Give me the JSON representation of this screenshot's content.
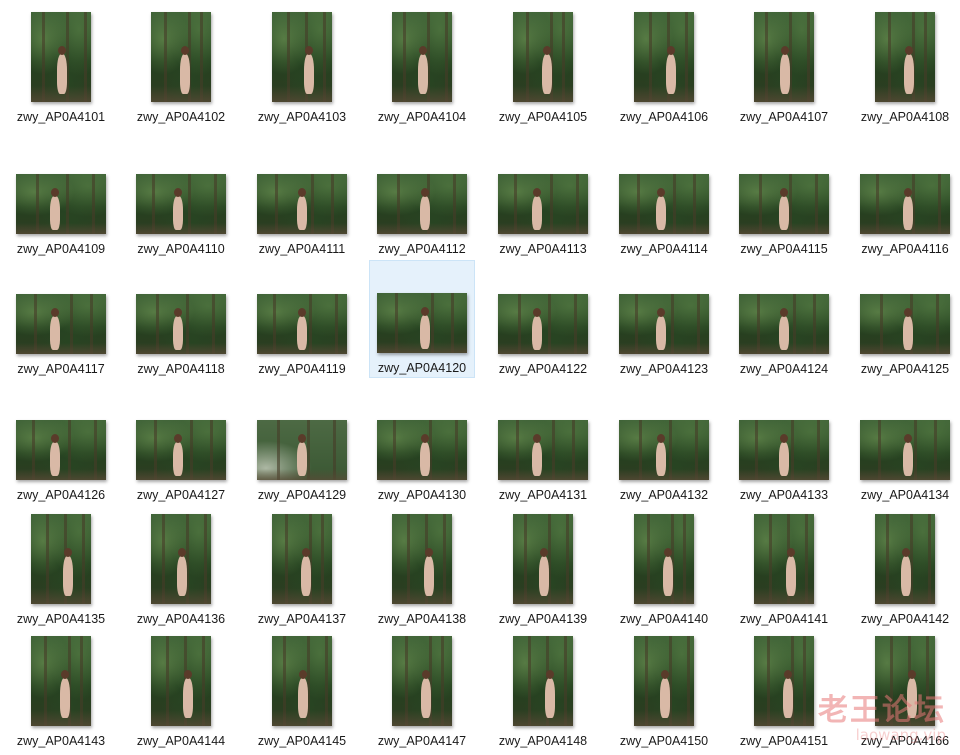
{
  "files": [
    {
      "name": "zwy_AP0A4101",
      "orientation": "portrait"
    },
    {
      "name": "zwy_AP0A4102",
      "orientation": "portrait"
    },
    {
      "name": "zwy_AP0A4103",
      "orientation": "portrait"
    },
    {
      "name": "zwy_AP0A4104",
      "orientation": "portrait"
    },
    {
      "name": "zwy_AP0A4105",
      "orientation": "portrait"
    },
    {
      "name": "zwy_AP0A4106",
      "orientation": "portrait"
    },
    {
      "name": "zwy_AP0A4107",
      "orientation": "portrait"
    },
    {
      "name": "zwy_AP0A4108",
      "orientation": "portrait"
    },
    {
      "name": "zwy_AP0A4109",
      "orientation": "landscape"
    },
    {
      "name": "zwy_AP0A4110",
      "orientation": "landscape"
    },
    {
      "name": "zwy_AP0A4111",
      "orientation": "landscape"
    },
    {
      "name": "zwy_AP0A4112",
      "orientation": "landscape"
    },
    {
      "name": "zwy_AP0A4113",
      "orientation": "landscape"
    },
    {
      "name": "zwy_AP0A4114",
      "orientation": "landscape"
    },
    {
      "name": "zwy_AP0A4115",
      "orientation": "landscape"
    },
    {
      "name": "zwy_AP0A4116",
      "orientation": "landscape"
    },
    {
      "name": "zwy_AP0A4117",
      "orientation": "landscape"
    },
    {
      "name": "zwy_AP0A4118",
      "orientation": "landscape"
    },
    {
      "name": "zwy_AP0A4119",
      "orientation": "landscape"
    },
    {
      "name": "zwy_AP0A4120",
      "orientation": "landscape",
      "selected": true
    },
    {
      "name": "zwy_AP0A4122",
      "orientation": "landscape"
    },
    {
      "name": "zwy_AP0A4123",
      "orientation": "landscape"
    },
    {
      "name": "zwy_AP0A4124",
      "orientation": "landscape"
    },
    {
      "name": "zwy_AP0A4125",
      "orientation": "landscape"
    },
    {
      "name": "zwy_AP0A4126",
      "orientation": "landscape"
    },
    {
      "name": "zwy_AP0A4127",
      "orientation": "landscape"
    },
    {
      "name": "zwy_AP0A4129",
      "orientation": "landscape",
      "variant": "pale"
    },
    {
      "name": "zwy_AP0A4130",
      "orientation": "landscape"
    },
    {
      "name": "zwy_AP0A4131",
      "orientation": "landscape"
    },
    {
      "name": "zwy_AP0A4132",
      "orientation": "landscape"
    },
    {
      "name": "zwy_AP0A4133",
      "orientation": "landscape"
    },
    {
      "name": "zwy_AP0A4134",
      "orientation": "landscape"
    },
    {
      "name": "zwy_AP0A4135",
      "orientation": "portrait"
    },
    {
      "name": "zwy_AP0A4136",
      "orientation": "portrait"
    },
    {
      "name": "zwy_AP0A4137",
      "orientation": "portrait"
    },
    {
      "name": "zwy_AP0A4138",
      "orientation": "portrait"
    },
    {
      "name": "zwy_AP0A4139",
      "orientation": "portrait"
    },
    {
      "name": "zwy_AP0A4140",
      "orientation": "portrait"
    },
    {
      "name": "zwy_AP0A4141",
      "orientation": "portrait"
    },
    {
      "name": "zwy_AP0A4142",
      "orientation": "portrait"
    },
    {
      "name": "zwy_AP0A4143",
      "orientation": "portrait"
    },
    {
      "name": "zwy_AP0A4144",
      "orientation": "portrait"
    },
    {
      "name": "zwy_AP0A4145",
      "orientation": "portrait"
    },
    {
      "name": "zwy_AP0A4147",
      "orientation": "portrait"
    },
    {
      "name": "zwy_AP0A4148",
      "orientation": "portrait"
    },
    {
      "name": "zwy_AP0A4150",
      "orientation": "portrait"
    },
    {
      "name": "zwy_AP0A4151",
      "orientation": "portrait"
    },
    {
      "name": "zwy_AP0A4166",
      "orientation": "portrait"
    }
  ],
  "selection_color": "#e5f1fb",
  "watermark": {
    "main": "老王论坛",
    "sub": "laowang.vip"
  }
}
